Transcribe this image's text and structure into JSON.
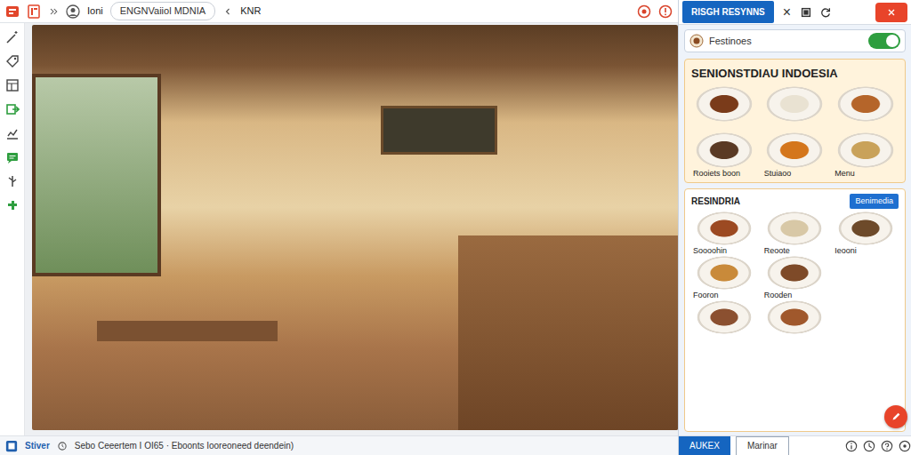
{
  "titlebar": {
    "app_label": "Ioni",
    "title": "ENGNVaiiol MDNIA",
    "right_label": "KNR"
  },
  "panel": {
    "tab": "RISGH RESYNNS",
    "close": "×",
    "search": {
      "value": "Festinoes",
      "toggle_on": true
    },
    "featured": {
      "title": "SENIONSTDIAU INDOESIA",
      "rows": [
        [
          {},
          {},
          {}
        ],
        [
          {
            "caption": "Rooiets boon"
          },
          {
            "caption": "Stuiaoo"
          },
          {
            "caption": "Menu"
          }
        ]
      ]
    },
    "list": {
      "title": "RESINDRIA",
      "badge": "Benimedia",
      "rows": [
        [
          {
            "caption": "Soooohin"
          },
          {
            "caption": "Reoote"
          },
          {
            "caption": "Ieooni"
          }
        ],
        [
          {
            "caption": "Fooron"
          },
          {
            "caption": "Rooden"
          }
        ],
        [
          {},
          {}
        ]
      ]
    }
  },
  "status_bar": {
    "label": "Stiver",
    "text": "Sebo Ceeertem I OI65 · Eboonts Iooreoneed deendein)",
    "buttons": [
      {
        "label": "AUKEX",
        "selected": true
      },
      {
        "label": "Marinar",
        "selected": false
      }
    ]
  }
}
